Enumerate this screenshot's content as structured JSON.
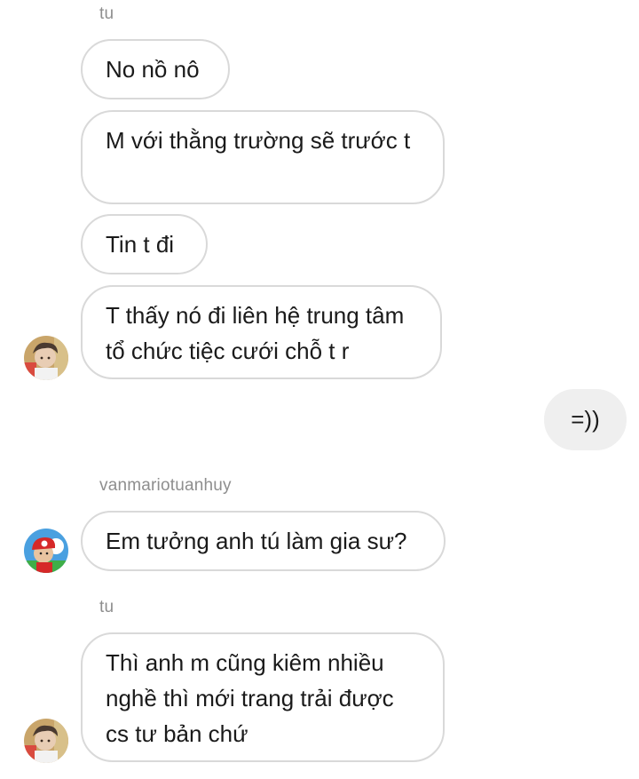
{
  "messages": [
    {
      "type": "sender",
      "name": "tu"
    },
    {
      "type": "in",
      "text": "No nồ nô"
    },
    {
      "type": "in",
      "text": "M với thằng trường sẽ trước t"
    },
    {
      "type": "in",
      "text": "Tin t đi"
    },
    {
      "type": "in",
      "text": "T thấy nó đi liên hệ trung tâm tổ chức tiệc cưới chỗ t r",
      "avatar": "tu-avatar"
    },
    {
      "type": "out",
      "text": "=))"
    },
    {
      "type": "sender",
      "name": "vanmariotuanhuy"
    },
    {
      "type": "in",
      "text": "Em tưởng anh tú làm gia sư?",
      "avatar": "mario-avatar"
    },
    {
      "type": "sender",
      "name": "tu"
    },
    {
      "type": "in",
      "text": "Thì anh m cũng kiêm nhiều nghề thì mới trang trải được cs tư bản chứ",
      "avatar": "tu-avatar"
    }
  ]
}
